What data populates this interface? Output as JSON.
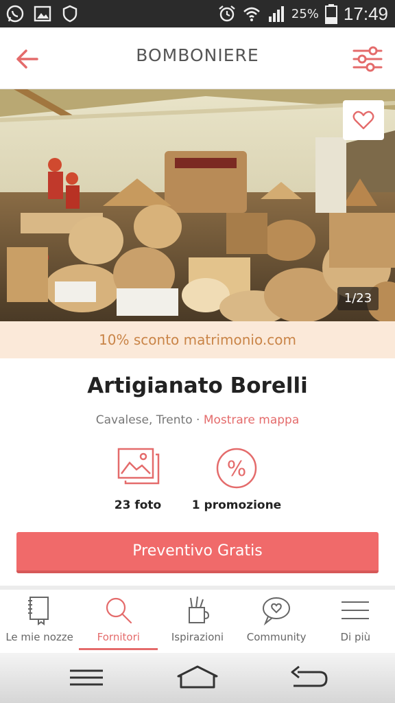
{
  "status_bar": {
    "battery_percent": "25%",
    "time": "17:49",
    "icons": [
      "whatsapp-icon",
      "gallery-icon",
      "shield-icon",
      "alarm-icon",
      "wifi-icon",
      "signal-icon",
      "battery-icon"
    ]
  },
  "header": {
    "title": "BOMBONIERE",
    "back_icon": "arrow-left-icon",
    "filter_icon": "sliders-icon"
  },
  "gallery": {
    "counter": "1/23",
    "favorite_icon": "heart-icon"
  },
  "promo_banner": "10% sconto matrimonio.com",
  "vendor": {
    "name": "Artigianato Borelli",
    "location": "Cavalese, Trento · ",
    "map_link": "Mostrare mappa"
  },
  "stats": {
    "photos_label": "23 foto",
    "promo_label": "1 promozione"
  },
  "cta_label": "Preventivo Gratis",
  "tabs": [
    {
      "label": "Le mie nozze",
      "icon": "notebook-icon",
      "active": false
    },
    {
      "label": "Fornitori",
      "icon": "search-icon",
      "active": true
    },
    {
      "label": "Ispirazioni",
      "icon": "pencil-cup-icon",
      "active": false
    },
    {
      "label": "Community",
      "icon": "chat-heart-icon",
      "active": false
    },
    {
      "label": "Di più",
      "icon": "menu-icon",
      "active": false
    }
  ],
  "colors": {
    "accent": "#f06a6a",
    "promo_bg": "#fbe9d9",
    "promo_text": "#c98447"
  }
}
